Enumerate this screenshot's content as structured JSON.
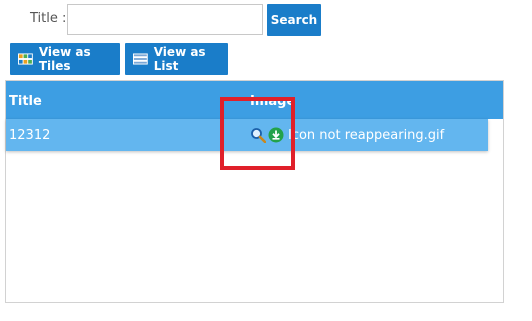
{
  "search": {
    "label": "Title :",
    "input_value": "",
    "input_placeholder": "",
    "button_label": "Search"
  },
  "view_buttons": {
    "tiles_label": "View as Tiles",
    "list_label": "View as List"
  },
  "grid": {
    "columns": [
      "Title",
      "Image"
    ],
    "rows": [
      {
        "title": "12312",
        "image_filename": "Icon not reappearing.gif",
        "icons": [
          "zoom-icon",
          "download-icon"
        ]
      }
    ]
  },
  "colors": {
    "button_bg": "#1a7dc9",
    "header_bg": "#3d9ee3",
    "row_bg": "#63b6ef",
    "annotation": "#e0202a"
  }
}
